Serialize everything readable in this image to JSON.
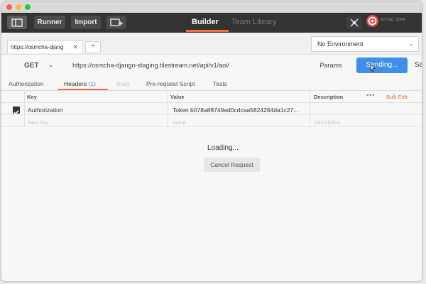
{
  "toolbar": {
    "runner_label": "Runner",
    "import_label": "Import",
    "tabs": [
      {
        "label": "Builder",
        "active": true
      },
      {
        "label": "Team Library",
        "active": false
      }
    ],
    "sync_label": "SYNC OFF"
  },
  "request_tabs": [
    {
      "label": "https://osmcha-djang"
    }
  ],
  "environment": {
    "selected": "No Environment"
  },
  "request": {
    "method": "GET",
    "url": "https://osmcha-django-staging.tilestream.net/api/v1/aoi/",
    "params_label": "Params",
    "send_label": "Sending...",
    "save_label": "Sa"
  },
  "subtabs": {
    "authorization": "Authorization",
    "headers": "Headers",
    "headers_count": "(1)",
    "body": "Body",
    "prerequest": "Pre-request Script",
    "tests": "Tests"
  },
  "headers_table": {
    "columns": {
      "key": "Key",
      "value": "Value",
      "description": "Description"
    },
    "more": "•••",
    "bulk_edit": "Bulk Edit",
    "rows": [
      {
        "key": "Authorization",
        "value": "Token b078a88749ad0cdcaa5824264da1c27...",
        "description": ""
      }
    ],
    "placeholder": {
      "key": "New key",
      "value": "Value",
      "description": "Description"
    }
  },
  "response": {
    "loading_text": "Loading...",
    "cancel_label": "Cancel Request"
  },
  "colors": {
    "accent": "#f26b3a",
    "send_button": "#3f8fe8",
    "toolbar": "#333333",
    "sync": "#e44b46"
  }
}
